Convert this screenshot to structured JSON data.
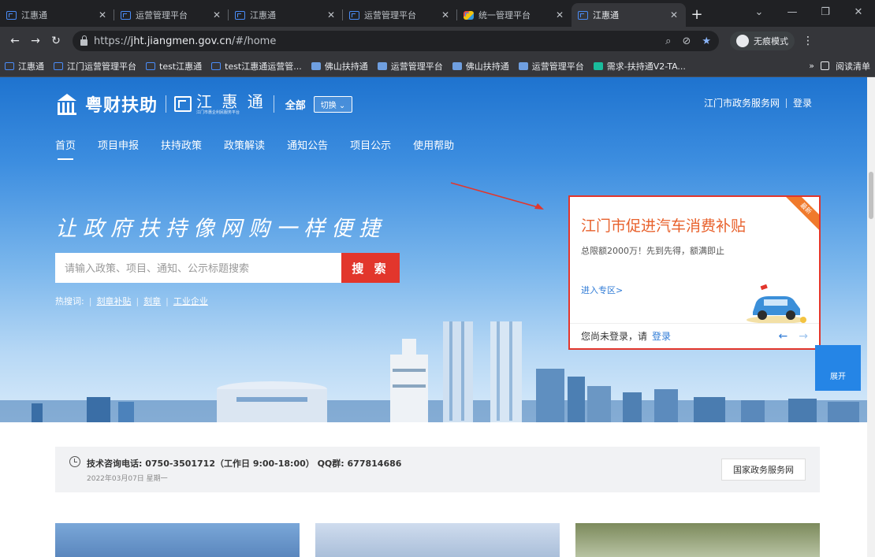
{
  "browser": {
    "tabs": [
      {
        "label": "江惠通",
        "active": false,
        "favicon": "jht-icon"
      },
      {
        "label": "运营管理平台",
        "active": false,
        "favicon": "jht-icon"
      },
      {
        "label": "江惠通",
        "active": false,
        "favicon": "jht-icon"
      },
      {
        "label": "运营管理平台",
        "active": false,
        "favicon": "jht-icon"
      },
      {
        "label": "统一管理平台",
        "active": false,
        "favicon": "colorful-icon"
      },
      {
        "label": "江惠通",
        "active": true,
        "favicon": "jht-icon"
      }
    ],
    "url_scheme": "https://",
    "url_host": "jht.jiangmen.gov.cn",
    "url_path": "/#/home",
    "incognito_label": "无痕模式",
    "bookmarks": [
      "江惠通",
      "江门运营管理平台",
      "test江惠通",
      "test江惠通运营管...",
      "佛山扶持通",
      "运营管理平台",
      "佛山扶持通",
      "运营管理平台",
      "需求-扶持通V2-TA..."
    ],
    "reading_list_label": "阅读清单"
  },
  "site": {
    "brand": "粤财扶助",
    "sub_brand": "江 惠 通",
    "sub_brand_tagline": "江门市惠企利民服务平台",
    "scope_label": "全部",
    "switch_label": "切换 ⌄",
    "gov_link": "江门市政务服务网",
    "login_link": "登录",
    "nav": [
      "首页",
      "项目申报",
      "扶持政策",
      "政策解读",
      "通知公告",
      "项目公示",
      "使用帮助"
    ],
    "slogan": "让政府扶持像网购一样便捷",
    "search_placeholder": "请输入政策、项目、通知、公示标题搜索",
    "search_button": "搜 索",
    "hot_label": "热搜词:",
    "hot_keywords": [
      "刻章补贴",
      "刻章",
      "工业企业"
    ]
  },
  "promo": {
    "badge": "最新",
    "title": "江门市促进汽车消费补贴",
    "subtitle": "总限额2000万！先到先得，额满即止",
    "enter_link": "进入专区>",
    "login_prompt": "您尚未登录，请",
    "login_link": "登录",
    "prev": "←",
    "next": "→"
  },
  "expand_button": "展开",
  "info": {
    "hotline": "技术咨询电话: 0750-3501712（工作日 9:00-18:00） QQ群: 677814686",
    "date": "2022年03月07日 星期一",
    "gov_button": "国家政务服务网"
  },
  "colors": {
    "brand_blue": "#1e73cf",
    "search_red": "#e2362c",
    "promo_orange": "#e8612c"
  }
}
